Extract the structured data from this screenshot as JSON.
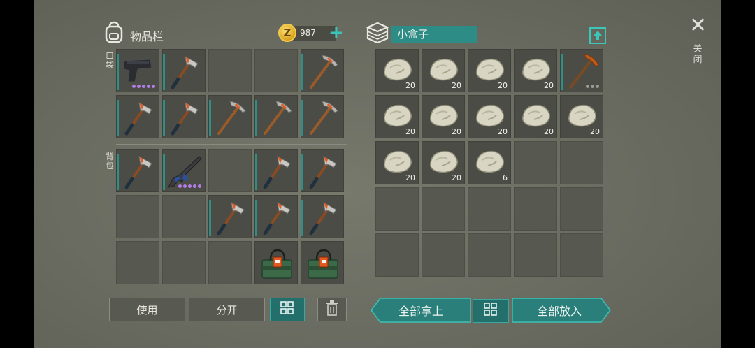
{
  "inventory": {
    "title": "物品栏",
    "coins": "987",
    "coin_symbol": "Z",
    "pocket_label": "口袋",
    "backpack_label": "背包"
  },
  "container": {
    "name": "小盒子"
  },
  "close_label": "关闭",
  "buttons": {
    "use": "使用",
    "split": "分开",
    "take_all": "全部拿上",
    "put_all": "全部放入"
  },
  "pocket_slots": [
    {
      "item": "pistol-icon",
      "accent": true,
      "dots": "purple"
    },
    {
      "item": "hatchet-icon",
      "accent": true
    },
    {
      "item": "empty"
    },
    {
      "item": "empty"
    },
    {
      "item": "pickaxe-icon",
      "accent": true
    },
    {
      "item": "hatchet-icon",
      "accent": true
    },
    {
      "item": "hatchet-icon",
      "accent": true
    },
    {
      "item": "pickaxe-icon",
      "accent": true
    },
    {
      "item": "pickaxe-icon",
      "accent": true
    },
    {
      "item": "pickaxe-icon",
      "accent": true
    }
  ],
  "backpack_slots": [
    {
      "item": "hatchet-icon",
      "accent": true
    },
    {
      "item": "rifle-icon",
      "accent": true,
      "dots": "purple"
    },
    {
      "item": "empty"
    },
    {
      "item": "hatchet-icon",
      "accent": true
    },
    {
      "item": "hatchet-icon",
      "accent": true
    },
    {
      "item": "empty"
    },
    {
      "item": "empty"
    },
    {
      "item": "hatchet-icon",
      "accent": true
    },
    {
      "item": "hatchet-icon",
      "accent": true
    },
    {
      "item": "hatchet-icon",
      "accent": true
    },
    {
      "item": "empty"
    },
    {
      "item": "empty"
    },
    {
      "item": "empty"
    },
    {
      "item": "explosive-icon"
    },
    {
      "item": "explosive-icon"
    }
  ],
  "box_slots": [
    {
      "item": "stone-icon",
      "qty": "20"
    },
    {
      "item": "stone-icon",
      "qty": "20"
    },
    {
      "item": "stone-icon",
      "qty": "20"
    },
    {
      "item": "stone-icon",
      "qty": "20"
    },
    {
      "item": "copper-pickaxe-icon",
      "accent": true,
      "dots": "gray"
    },
    {
      "item": "stone-icon",
      "qty": "20"
    },
    {
      "item": "stone-icon",
      "qty": "20"
    },
    {
      "item": "stone-icon",
      "qty": "20"
    },
    {
      "item": "stone-icon",
      "qty": "20"
    },
    {
      "item": "stone-icon",
      "qty": "20"
    },
    {
      "item": "stone-icon",
      "qty": "20"
    },
    {
      "item": "stone-icon",
      "qty": "20"
    },
    {
      "item": "stone-icon",
      "qty": "6"
    },
    {
      "item": "empty"
    },
    {
      "item": "empty"
    }
  ],
  "colors": {
    "accent_teal": "#2f8f86",
    "rarity_purple": "#b47ce8"
  }
}
